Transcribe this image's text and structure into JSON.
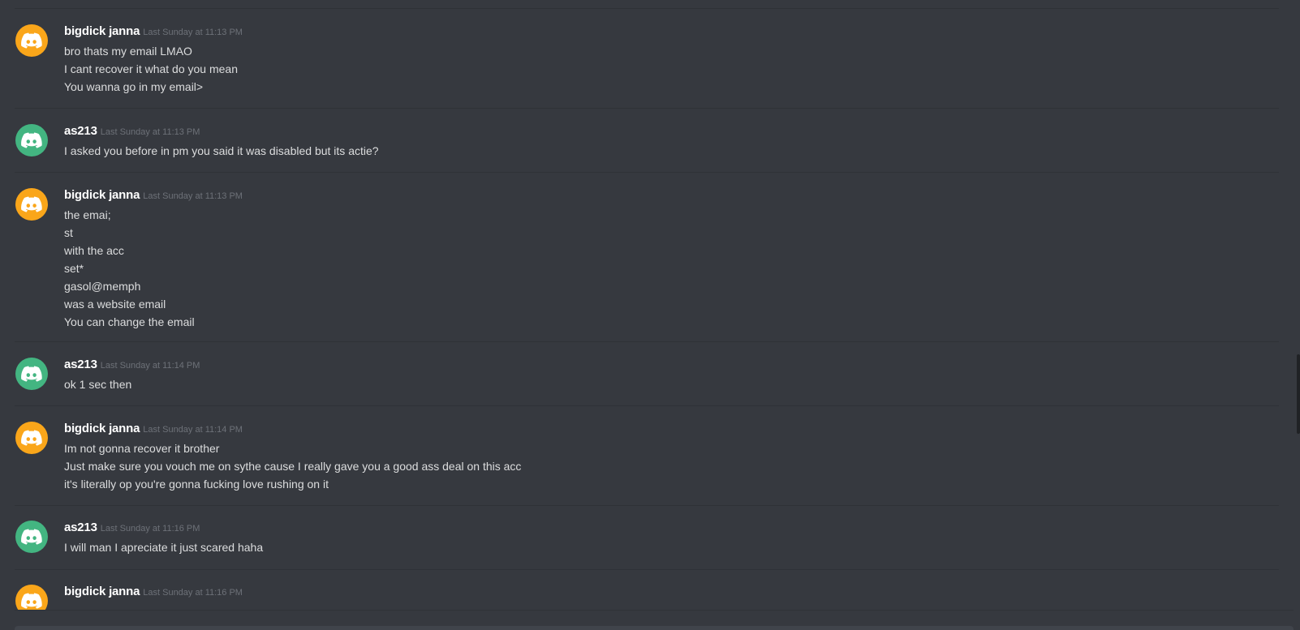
{
  "colors": {
    "background": "#36393f",
    "avatar_orange": "#faa61a",
    "avatar_green": "#43b581",
    "username": "#ffffff",
    "timestamp": "#6d7178",
    "message_text": "#dcddde"
  },
  "messages": [
    {
      "username": "bigdick janna",
      "timestamp": "Last Sunday at 11:13 PM",
      "avatar_icon": "discord-logo-icon",
      "avatar_color": "#faa61a",
      "lines": [
        "bro thats my email LMAO",
        "I cant recover it what do you mean",
        "You wanna go in my email>"
      ]
    },
    {
      "username": "as213",
      "timestamp": "Last Sunday at 11:13 PM",
      "avatar_icon": "discord-logo-icon",
      "avatar_color": "#43b581",
      "lines": [
        "I asked you before in pm you said it was disabled but its actie?"
      ]
    },
    {
      "username": "bigdick janna",
      "timestamp": "Last Sunday at 11:13 PM",
      "avatar_icon": "discord-logo-icon",
      "avatar_color": "#faa61a",
      "lines": [
        "the emai;",
        "st",
        "with the acc",
        "set*",
        "gasol@memph",
        "was a website email",
        "You can change the email"
      ]
    },
    {
      "username": "as213",
      "timestamp": "Last Sunday at 11:14 PM",
      "avatar_icon": "discord-logo-icon",
      "avatar_color": "#43b581",
      "lines": [
        "ok 1 sec then"
      ]
    },
    {
      "username": "bigdick janna",
      "timestamp": "Last Sunday at 11:14 PM",
      "avatar_icon": "discord-logo-icon",
      "avatar_color": "#faa61a",
      "lines": [
        "Im not gonna recover it brother",
        "Just make sure you vouch me on sythe cause I really gave you a good ass deal on this acc",
        "it's literally op you're gonna fucking love rushing on it"
      ]
    },
    {
      "username": "as213",
      "timestamp": "Last Sunday at 11:16 PM",
      "avatar_icon": "discord-logo-icon",
      "avatar_color": "#43b581",
      "lines": [
        "I will man I apreciate it just scared haha"
      ]
    },
    {
      "username": "bigdick janna",
      "timestamp": "Last Sunday at 11:16 PM",
      "avatar_icon": "discord-logo-icon",
      "avatar_color": "#faa61a",
      "lines": []
    }
  ]
}
